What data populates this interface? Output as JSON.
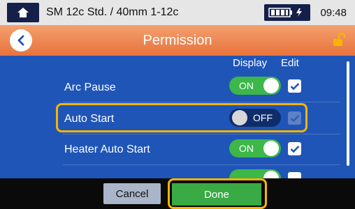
{
  "status_bar": {
    "home_icon": "home-icon",
    "title": "SM 12c Std. / 40mm 1-12c",
    "battery_icon": "battery-icon",
    "time": "09:48"
  },
  "header": {
    "back_icon": "chevron-left-icon",
    "title": "Permission",
    "lock_icon": "unlock-icon"
  },
  "columns": {
    "display": "Display",
    "edit": "Edit"
  },
  "rows": [
    {
      "label": "Arc Pause",
      "toggle": "ON",
      "state": "on",
      "edit_checked": true,
      "edit_enabled": true
    },
    {
      "label": "Auto Start",
      "toggle": "OFF",
      "state": "off",
      "edit_checked": true,
      "edit_enabled": false
    },
    {
      "label": "Heater Auto Start",
      "toggle": "ON",
      "state": "on",
      "edit_checked": true,
      "edit_enabled": true
    }
  ],
  "footer": {
    "cancel": "Cancel",
    "done": "Done"
  },
  "colors": {
    "accent_orange": "#e8723c",
    "background_blue": "#1f55b7",
    "on_green": "#3db74a",
    "highlight_yellow": "#f7b500"
  }
}
